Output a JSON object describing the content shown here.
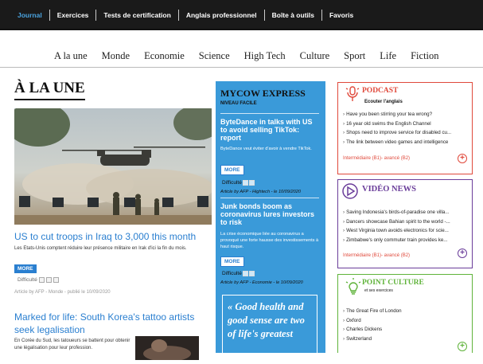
{
  "topnav": {
    "items": [
      "Journal",
      "Exercices",
      "Tests de certification",
      "Anglais professionnel",
      "Boîte à outils",
      "Favoris"
    ],
    "active": "Journal"
  },
  "categories": [
    "A la une",
    "Monde",
    "Economie",
    "Science",
    "High Tech",
    "Culture",
    "Sport",
    "Life",
    "Fiction"
  ],
  "alaune": {
    "section_title": "À LA UNE",
    "articles": [
      {
        "title": "US to cut troops in Iraq to 3,000 this month",
        "summary": "Les Etats-Unis comptent réduire leur présence militaire en Irak d'ici la fin du mois.",
        "more": "MORE",
        "difficulty_label": "Difficulté",
        "meta": "Article by AFP - Monde - publié le 10/09/2020"
      },
      {
        "title": "Marked for life: South Korea's tattoo artists seek legalisation",
        "summary": "En Corée du Sud, les tatoueurs se battent pour obtenir une légalisation pour leur profession."
      }
    ]
  },
  "express": {
    "title": "MYCOW EXPRESS",
    "subtitle": "NIVEAU FACILE",
    "items": [
      {
        "title": "ByteDance in talks with US to avoid selling TikTok: report",
        "summary": "ByteDance veut éviter d'avoir à vendre TikTok.",
        "more": "MORE",
        "difficulty_label": "Difficulté",
        "meta": "Article by AFP - Hightech - le 10/09/2020"
      },
      {
        "title": "Junk bonds boom as coronavirus lures investors to risk",
        "summary": "La crise économique liée au coronavirus a provoqué une forte hausse des investissements à haut risque.",
        "more": "MORE",
        "difficulty_label": "Difficulté",
        "meta": "Article by AFP - Economie - le 10/09/2020"
      }
    ],
    "quote": "« Good health and good sense are two of life's greatest"
  },
  "cards": {
    "podcast": {
      "title": "PODCAST",
      "subtitle": "Ecouter l'anglais",
      "items": [
        "Have you been stirring your tea wrong?",
        "16 year old swims the English Channel",
        "Shops need to improve service for disabled cu...",
        "The link between video games and intelligence"
      ],
      "level": "Intermédiaire (B1)- avancé (B2)",
      "color": "#e0493b"
    },
    "video": {
      "title": "VIDÉO NEWS",
      "items": [
        "Saving Indonesia's birds-of-paradise one villa...",
        "Dancers showcase Bahian spirit to the world -...",
        "West Virginia town avoids electronics for scie...",
        "Zimbabwe's only commuter train provides ke..."
      ],
      "level": "Intermédiaire (B1)- avancé (B2)",
      "color": "#6a3d9a"
    },
    "culture": {
      "title": "POINT CULTURE",
      "subtitle": "et ses exercices",
      "items": [
        "The Great Fire of London",
        "Oxford",
        "Charles Dickens",
        "Switzerland"
      ],
      "color": "#5fb33a"
    }
  }
}
